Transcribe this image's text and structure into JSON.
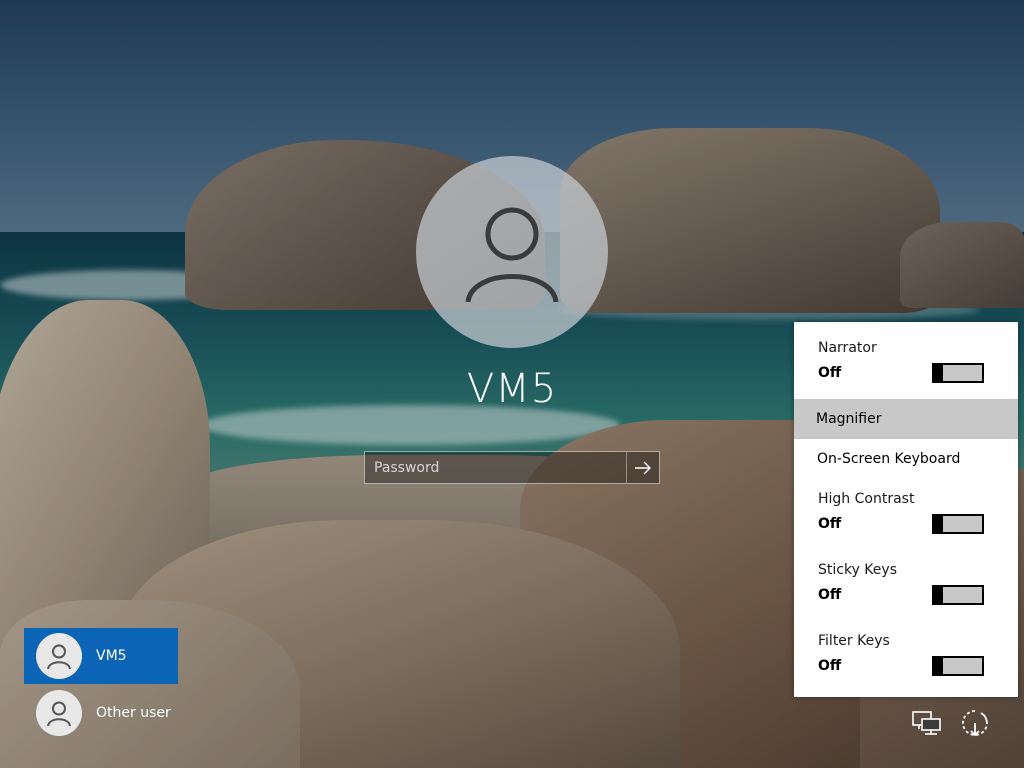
{
  "user": {
    "name": "VM5"
  },
  "password": {
    "placeholder": "Password"
  },
  "users_list": [
    {
      "label": "VM5",
      "selected": true
    },
    {
      "label": "Other user",
      "selected": false
    }
  ],
  "ease_of_access": {
    "narrator": {
      "label": "Narrator",
      "state": "Off"
    },
    "magnifier": {
      "label": "Magnifier"
    },
    "onscreen_keyboard": {
      "label": "On-Screen Keyboard"
    },
    "high_contrast": {
      "label": "High Contrast",
      "state": "Off"
    },
    "sticky_keys": {
      "label": "Sticky Keys",
      "state": "Off"
    },
    "filter_keys": {
      "label": "Filter Keys",
      "state": "Off"
    }
  },
  "icons": {
    "submit": "arrow-right-icon",
    "network": "network-icon",
    "power": "power-icon",
    "user": "user-icon"
  },
  "colors": {
    "selected_user_bg": "#0b64b5",
    "flyout_hover_bg": "#c8c8c8",
    "flyout_bg": "#ffffff"
  }
}
